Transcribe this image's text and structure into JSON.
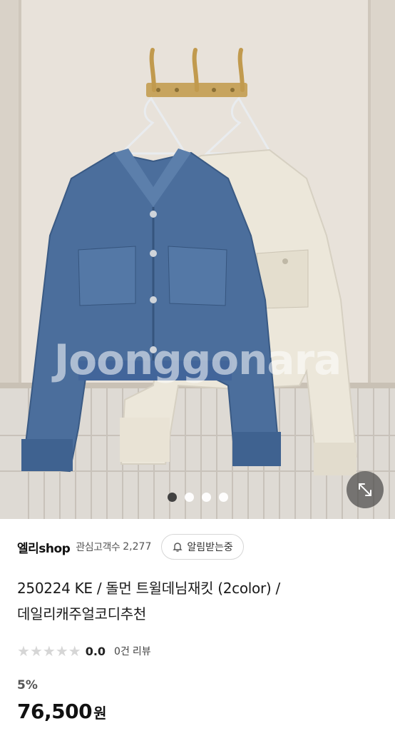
{
  "image": {
    "watermark": "Joonggonara",
    "carousel": {
      "total": 4,
      "active_index": 0
    }
  },
  "store": {
    "name": "엘리shop",
    "favorites_label": "관심고객수",
    "favorites_count": "2,277",
    "notify_label": "알림받는중"
  },
  "product": {
    "title_line1": "250224 KE / 돌먼 트윌데님재킷 (2color) /",
    "title_line2": "데일리캐주얼코디추천"
  },
  "rating": {
    "value": "0.0",
    "stars_filled": 0,
    "stars_total": 5,
    "review_count": "0건",
    "review_label": "리뷰"
  },
  "pricing": {
    "discount": "5%",
    "price": "76,500",
    "currency": "원"
  },
  "icons": [
    "bell-icon",
    "expand-icon",
    "star-icon"
  ],
  "colors": {
    "denim": "#4b6e9c",
    "cream": "#ece7da",
    "wall": "#e6e0d8"
  }
}
